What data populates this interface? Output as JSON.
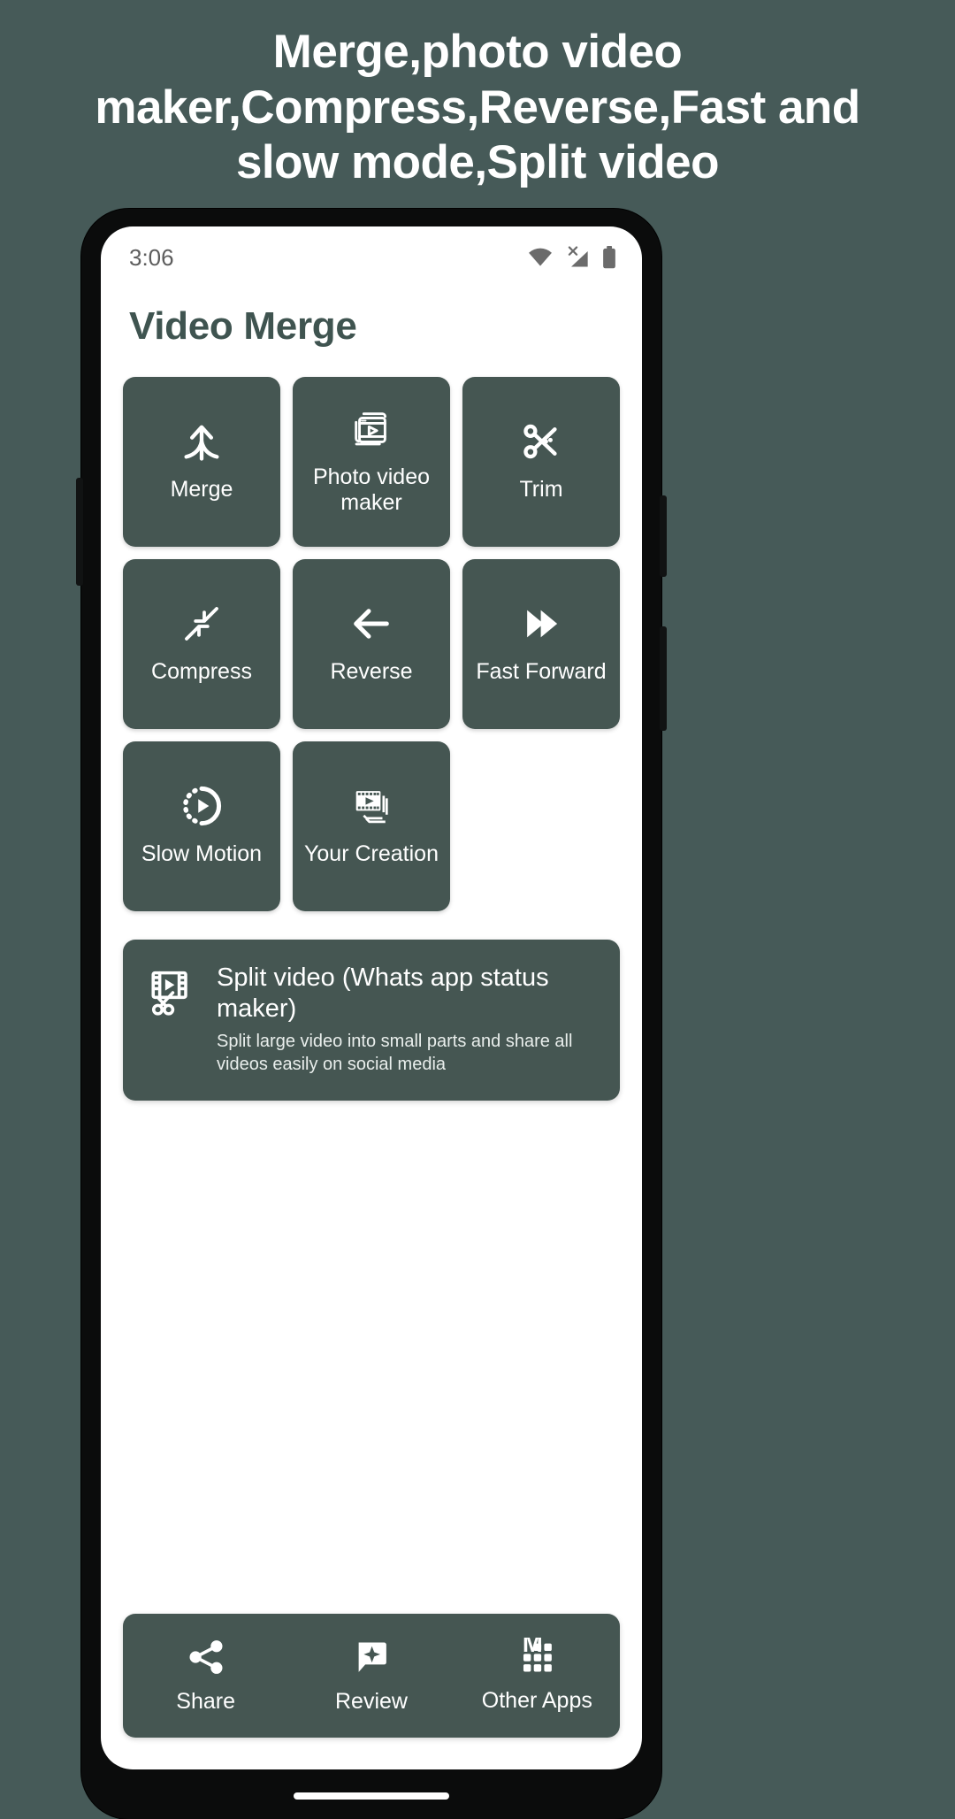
{
  "promo": {
    "headline": "Merge,photo video maker,Compress,Reverse,Fast and slow mode,Split video"
  },
  "colors": {
    "background": "#465A58",
    "tile": "#455652",
    "screen": "#FFFFFF",
    "title_text": "#3F5450",
    "tile_text": "#FFFFFF",
    "status_text": "#5D5D5D"
  },
  "status_bar": {
    "time": "3:06",
    "icons": [
      "wifi-icon",
      "mobile-signal-no-sim-icon",
      "battery-icon"
    ]
  },
  "app": {
    "title": "Video Merge"
  },
  "grid": {
    "tiles": [
      {
        "label": "Merge",
        "icon": "merge-arrows-icon"
      },
      {
        "label": "Photo video maker",
        "icon": "photo-video-stack-icon"
      },
      {
        "label": "Trim",
        "icon": "scissors-icon"
      },
      {
        "label": "Compress",
        "icon": "compress-arrows-icon"
      },
      {
        "label": "Reverse",
        "icon": "arrow-left-icon"
      },
      {
        "label": "Fast Forward",
        "icon": "fast-forward-icon"
      },
      {
        "label": "Slow Motion",
        "icon": "slow-motion-play-icon"
      },
      {
        "label": "Your Creation",
        "icon": "film-stack-icon"
      }
    ]
  },
  "banner": {
    "icon": "film-scissors-icon",
    "title": "Split video (Whats app status maker)",
    "subtitle": "Split large video into small parts and share all videos easily on social media"
  },
  "bottom_bar": {
    "items": [
      {
        "label": "Share",
        "icon": "share-nodes-icon"
      },
      {
        "label": "Review",
        "icon": "review-star-bubble-icon"
      },
      {
        "label": "Other Apps",
        "icon": "apps-grid-icon"
      }
    ]
  }
}
